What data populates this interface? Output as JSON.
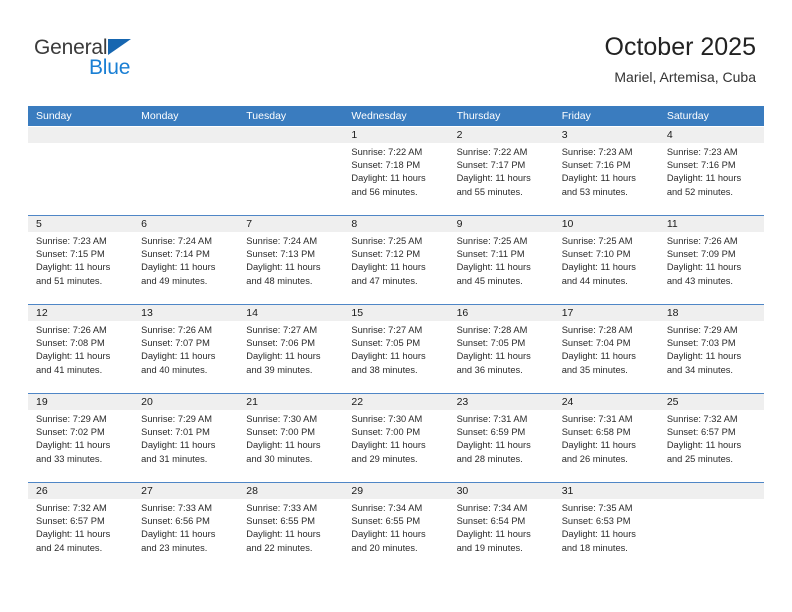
{
  "brand": {
    "name_part1": "General",
    "name_part2": "Blue",
    "accent_color": "#1a7fd4",
    "triangle_color": "#1666b0"
  },
  "header": {
    "title": "October 2025",
    "subtitle": "Mariel, Artemisa, Cuba"
  },
  "calendar": {
    "header_bg": "#3a7cbf",
    "band_bg": "#efefef",
    "weekdays": [
      "Sunday",
      "Monday",
      "Tuesday",
      "Wednesday",
      "Thursday",
      "Friday",
      "Saturday"
    ],
    "weeks": [
      {
        "days": [
          {
            "num": "",
            "lines": []
          },
          {
            "num": "",
            "lines": []
          },
          {
            "num": "",
            "lines": []
          },
          {
            "num": "1",
            "lines": [
              "Sunrise: 7:22 AM",
              "Sunset: 7:18 PM",
              "Daylight: 11 hours",
              "and 56 minutes."
            ]
          },
          {
            "num": "2",
            "lines": [
              "Sunrise: 7:22 AM",
              "Sunset: 7:17 PM",
              "Daylight: 11 hours",
              "and 55 minutes."
            ]
          },
          {
            "num": "3",
            "lines": [
              "Sunrise: 7:23 AM",
              "Sunset: 7:16 PM",
              "Daylight: 11 hours",
              "and 53 minutes."
            ]
          },
          {
            "num": "4",
            "lines": [
              "Sunrise: 7:23 AM",
              "Sunset: 7:16 PM",
              "Daylight: 11 hours",
              "and 52 minutes."
            ]
          }
        ]
      },
      {
        "days": [
          {
            "num": "5",
            "lines": [
              "Sunrise: 7:23 AM",
              "Sunset: 7:15 PM",
              "Daylight: 11 hours",
              "and 51 minutes."
            ]
          },
          {
            "num": "6",
            "lines": [
              "Sunrise: 7:24 AM",
              "Sunset: 7:14 PM",
              "Daylight: 11 hours",
              "and 49 minutes."
            ]
          },
          {
            "num": "7",
            "lines": [
              "Sunrise: 7:24 AM",
              "Sunset: 7:13 PM",
              "Daylight: 11 hours",
              "and 48 minutes."
            ]
          },
          {
            "num": "8",
            "lines": [
              "Sunrise: 7:25 AM",
              "Sunset: 7:12 PM",
              "Daylight: 11 hours",
              "and 47 minutes."
            ]
          },
          {
            "num": "9",
            "lines": [
              "Sunrise: 7:25 AM",
              "Sunset: 7:11 PM",
              "Daylight: 11 hours",
              "and 45 minutes."
            ]
          },
          {
            "num": "10",
            "lines": [
              "Sunrise: 7:25 AM",
              "Sunset: 7:10 PM",
              "Daylight: 11 hours",
              "and 44 minutes."
            ]
          },
          {
            "num": "11",
            "lines": [
              "Sunrise: 7:26 AM",
              "Sunset: 7:09 PM",
              "Daylight: 11 hours",
              "and 43 minutes."
            ]
          }
        ]
      },
      {
        "days": [
          {
            "num": "12",
            "lines": [
              "Sunrise: 7:26 AM",
              "Sunset: 7:08 PM",
              "Daylight: 11 hours",
              "and 41 minutes."
            ]
          },
          {
            "num": "13",
            "lines": [
              "Sunrise: 7:26 AM",
              "Sunset: 7:07 PM",
              "Daylight: 11 hours",
              "and 40 minutes."
            ]
          },
          {
            "num": "14",
            "lines": [
              "Sunrise: 7:27 AM",
              "Sunset: 7:06 PM",
              "Daylight: 11 hours",
              "and 39 minutes."
            ]
          },
          {
            "num": "15",
            "lines": [
              "Sunrise: 7:27 AM",
              "Sunset: 7:05 PM",
              "Daylight: 11 hours",
              "and 38 minutes."
            ]
          },
          {
            "num": "16",
            "lines": [
              "Sunrise: 7:28 AM",
              "Sunset: 7:05 PM",
              "Daylight: 11 hours",
              "and 36 minutes."
            ]
          },
          {
            "num": "17",
            "lines": [
              "Sunrise: 7:28 AM",
              "Sunset: 7:04 PM",
              "Daylight: 11 hours",
              "and 35 minutes."
            ]
          },
          {
            "num": "18",
            "lines": [
              "Sunrise: 7:29 AM",
              "Sunset: 7:03 PM",
              "Daylight: 11 hours",
              "and 34 minutes."
            ]
          }
        ]
      },
      {
        "days": [
          {
            "num": "19",
            "lines": [
              "Sunrise: 7:29 AM",
              "Sunset: 7:02 PM",
              "Daylight: 11 hours",
              "and 33 minutes."
            ]
          },
          {
            "num": "20",
            "lines": [
              "Sunrise: 7:29 AM",
              "Sunset: 7:01 PM",
              "Daylight: 11 hours",
              "and 31 minutes."
            ]
          },
          {
            "num": "21",
            "lines": [
              "Sunrise: 7:30 AM",
              "Sunset: 7:00 PM",
              "Daylight: 11 hours",
              "and 30 minutes."
            ]
          },
          {
            "num": "22",
            "lines": [
              "Sunrise: 7:30 AM",
              "Sunset: 7:00 PM",
              "Daylight: 11 hours",
              "and 29 minutes."
            ]
          },
          {
            "num": "23",
            "lines": [
              "Sunrise: 7:31 AM",
              "Sunset: 6:59 PM",
              "Daylight: 11 hours",
              "and 28 minutes."
            ]
          },
          {
            "num": "24",
            "lines": [
              "Sunrise: 7:31 AM",
              "Sunset: 6:58 PM",
              "Daylight: 11 hours",
              "and 26 minutes."
            ]
          },
          {
            "num": "25",
            "lines": [
              "Sunrise: 7:32 AM",
              "Sunset: 6:57 PM",
              "Daylight: 11 hours",
              "and 25 minutes."
            ]
          }
        ]
      },
      {
        "days": [
          {
            "num": "26",
            "lines": [
              "Sunrise: 7:32 AM",
              "Sunset: 6:57 PM",
              "Daylight: 11 hours",
              "and 24 minutes."
            ]
          },
          {
            "num": "27",
            "lines": [
              "Sunrise: 7:33 AM",
              "Sunset: 6:56 PM",
              "Daylight: 11 hours",
              "and 23 minutes."
            ]
          },
          {
            "num": "28",
            "lines": [
              "Sunrise: 7:33 AM",
              "Sunset: 6:55 PM",
              "Daylight: 11 hours",
              "and 22 minutes."
            ]
          },
          {
            "num": "29",
            "lines": [
              "Sunrise: 7:34 AM",
              "Sunset: 6:55 PM",
              "Daylight: 11 hours",
              "and 20 minutes."
            ]
          },
          {
            "num": "30",
            "lines": [
              "Sunrise: 7:34 AM",
              "Sunset: 6:54 PM",
              "Daylight: 11 hours",
              "and 19 minutes."
            ]
          },
          {
            "num": "31",
            "lines": [
              "Sunrise: 7:35 AM",
              "Sunset: 6:53 PM",
              "Daylight: 11 hours",
              "and 18 minutes."
            ]
          },
          {
            "num": "",
            "lines": []
          }
        ]
      }
    ]
  }
}
